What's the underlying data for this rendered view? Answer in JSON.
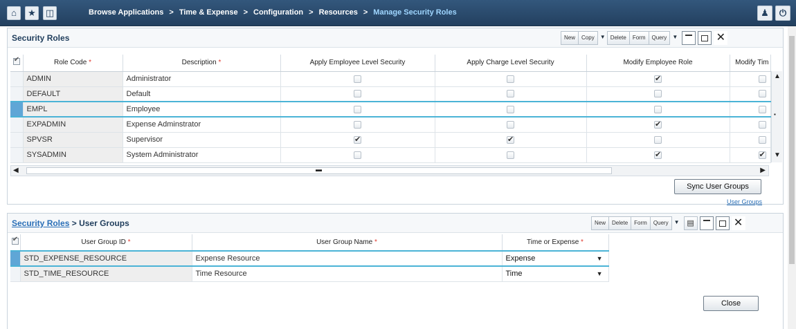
{
  "nav": {
    "home_glyph": "⌂",
    "star_glyph": "★",
    "menu_glyph": "◫",
    "breadcrumbs": [
      "Browse Applications",
      "Time & Expense",
      "Configuration",
      "Resources"
    ],
    "current": "Manage Security Roles",
    "separator": ">",
    "user_glyph": "👤",
    "power_glyph": "⏻"
  },
  "security_roles": {
    "title": "Security Roles",
    "toolbar": {
      "new": "New",
      "copy": "Copy",
      "delete": "Delete",
      "form": "Form",
      "query": "Query"
    },
    "columns": [
      "Role Code",
      "Description",
      "Apply Employee Level Security",
      "Apply Charge Level Security",
      "Modify Employee Role",
      "Modify Tim"
    ],
    "required_mark": "*",
    "rows": [
      {
        "code": "ADMIN",
        "description": "Administrator",
        "emp_sec": false,
        "charge_sec": false,
        "modify_emp_role": true,
        "modify_time": false
      },
      {
        "code": "DEFAULT",
        "description": "Default",
        "emp_sec": false,
        "charge_sec": false,
        "modify_emp_role": false,
        "modify_time": false
      },
      {
        "code": "EMPL",
        "description": "Employee",
        "emp_sec": false,
        "charge_sec": false,
        "modify_emp_role": false,
        "modify_time": false,
        "selected": true
      },
      {
        "code": "EXPADMIN",
        "description": "Expense Adminstrator",
        "emp_sec": false,
        "charge_sec": false,
        "modify_emp_role": true,
        "modify_time": false
      },
      {
        "code": "SPVSR",
        "description": "Supervisor",
        "emp_sec": true,
        "charge_sec": true,
        "modify_emp_role": false,
        "modify_time": false
      },
      {
        "code": "SYSADMIN",
        "description": "System Administrator",
        "emp_sec": false,
        "charge_sec": false,
        "modify_emp_role": true,
        "modify_time": true
      }
    ],
    "sync_button": "Sync User Groups",
    "user_groups_link": "User Groups"
  },
  "user_groups": {
    "title_link": "Security Roles",
    "title_separator": ">",
    "title": "User Groups",
    "toolbar": {
      "new": "New",
      "delete": "Delete",
      "form": "Form",
      "query": "Query"
    },
    "columns": [
      "User Group ID",
      "User Group Name",
      "Time or Expense"
    ],
    "required_mark": "*",
    "rows": [
      {
        "id": "STD_EXPENSE_RESOURCE",
        "name": "Expense Resource",
        "type": "Expense",
        "selected": true
      },
      {
        "id": "STD_TIME_RESOURCE",
        "name": "Time Resource",
        "type": "Time"
      }
    ]
  },
  "close_button": "Close",
  "colors": {
    "nav_bar": "#2b4a6b",
    "selection": "#4ab3d6",
    "link": "#2a6fb7",
    "required": "#e03a2f"
  }
}
